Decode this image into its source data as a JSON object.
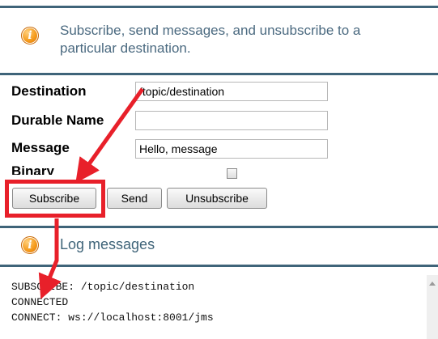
{
  "section_header": {
    "line1": "Subscribe, send messages, and unsubscribe to a",
    "line2": "particular destination."
  },
  "form": {
    "destination_label": "Destination",
    "destination_value": "/topic/destination",
    "durable_name_label": "Durable Name",
    "durable_name_value": "",
    "message_label": "Message",
    "message_value": "Hello, message",
    "binary_label": "Binary",
    "binary_checked": false
  },
  "buttons": {
    "subscribe": "Subscribe",
    "send": "Send",
    "unsubscribe": "Unsubscribe"
  },
  "log_header": "Log messages",
  "log": [
    "SUBSCRIBE: /topic/destination",
    "CONNECTED",
    "CONNECT: ws://localhost:8001/jms"
  ],
  "colors": {
    "rule": "#3f6479",
    "header_text": "#4b6a80",
    "annotation_red": "#e8202a"
  },
  "icons": [
    "info-icon",
    "checkbox-icon",
    "scroll-up-icon",
    "annotation-arrow-icon"
  ]
}
